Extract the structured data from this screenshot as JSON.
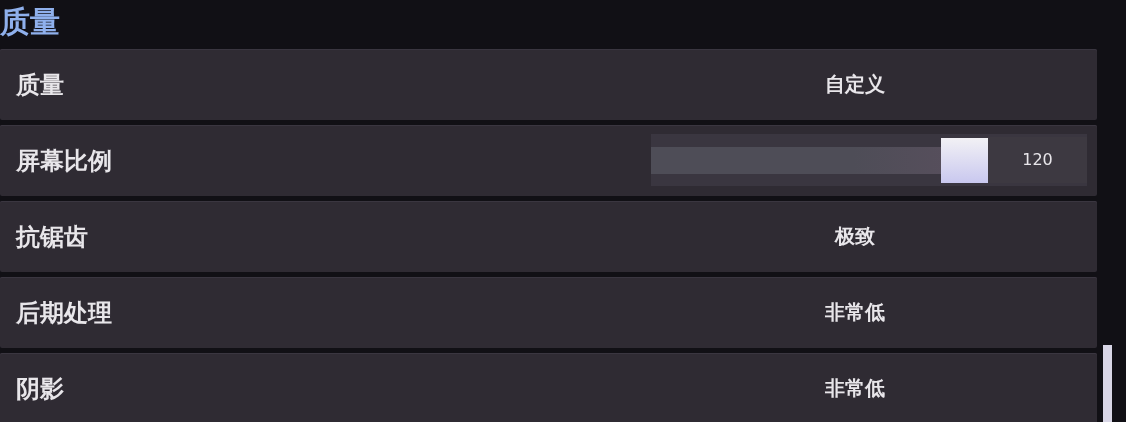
{
  "section_title": "质量",
  "settings": [
    {
      "kind": "value",
      "label": "质量",
      "value": "自定义"
    },
    {
      "kind": "slider",
      "label": "屏幕比例",
      "level": 1.0,
      "reading": "120"
    },
    {
      "kind": "value",
      "label": "抗锯齿",
      "value": "极致"
    },
    {
      "kind": "value",
      "label": "后期处理",
      "value": "非常低"
    },
    {
      "kind": "value",
      "label": "阴影",
      "value": "非常低"
    }
  ]
}
